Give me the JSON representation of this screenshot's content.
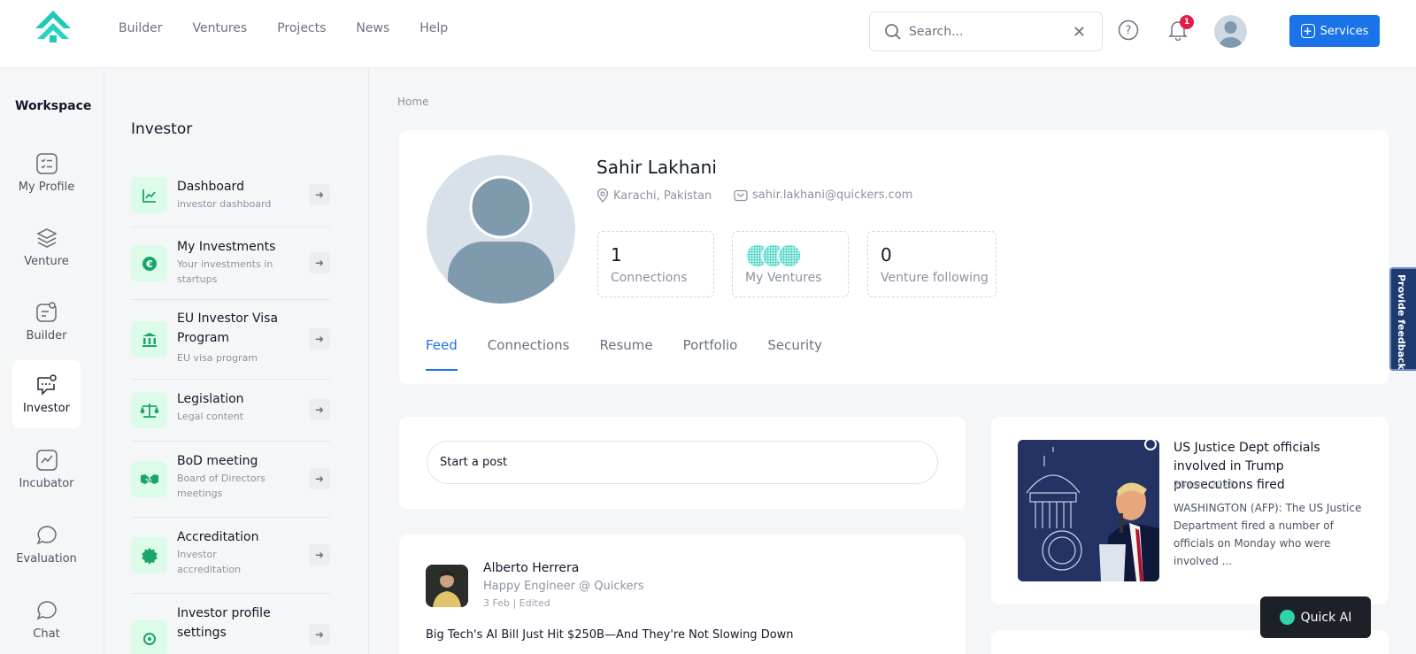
{
  "header": {
    "nav": [
      "Builder",
      "Ventures",
      "Projects",
      "News",
      "Help"
    ],
    "search_placeholder": "Search...",
    "notification_count": "1",
    "services_label": "Services"
  },
  "workspace": {
    "title": "Workspace",
    "items": [
      {
        "label": "My Profile",
        "icon": "profile-icon"
      },
      {
        "label": "Venture",
        "icon": "layers-icon"
      },
      {
        "label": "Builder",
        "icon": "builder-icon"
      },
      {
        "label": "Investor",
        "icon": "investor-icon",
        "active": true
      },
      {
        "label": "Incubator",
        "icon": "chart-icon"
      },
      {
        "label": "Evaluation",
        "icon": "chat-bubble-icon"
      },
      {
        "label": "Chat",
        "icon": "chat-icon"
      }
    ]
  },
  "subnav": {
    "title": "Investor",
    "items": [
      {
        "title": "Dashboard",
        "desc": "investor dashboard"
      },
      {
        "title": "My Investments",
        "desc": "Your investments in startups"
      },
      {
        "title": "EU Investor Visa Program",
        "desc": "EU visa program"
      },
      {
        "title": "Legislation",
        "desc": "Legal content"
      },
      {
        "title": "BoD meeting",
        "desc": "Board of Directors meetings"
      },
      {
        "title": "Accreditation",
        "desc": "Investor accreditation"
      },
      {
        "title": "Investor profile settings",
        "desc": ""
      }
    ]
  },
  "breadcrumb": "Home",
  "profile": {
    "name": "Sahir Lakhani",
    "location": "Karachi, Pakistan",
    "email": "sahir.lakhani@quickers.com",
    "connections_count": "1",
    "connections_label": "Connections",
    "ventures_label": "My Ventures",
    "following_count": "0",
    "following_label": "Venture following",
    "tabs": [
      "Feed",
      "Connections",
      "Resume",
      "Portfolio",
      "Security"
    ],
    "active_tab": "Feed"
  },
  "post_box": {
    "placeholder": "Start a post"
  },
  "feed_post": {
    "author": "Alberto Herrera",
    "role": "Happy Engineer @ Quickers",
    "date": "3 Feb | Edited",
    "text": "Big Tech's AI Bill Just Hit $250B—And They're Not Slowing Down"
  },
  "news": {
    "title": "US Justice Dept officials involved in Trump prosecutions fired",
    "date": "28 Jan, 2025",
    "body": "WASHINGTON (AFP): The US Justice Department fired a number of officials on Monday who were involved ..."
  },
  "quick_ai_label": "Quick AI",
  "feedback_label": "Provide feedback",
  "colors": {
    "accent": "#1a73e8",
    "brand_teal": "#1fc8b8",
    "icon_green": "#1aa56b",
    "badge_red": "#e11d48"
  }
}
